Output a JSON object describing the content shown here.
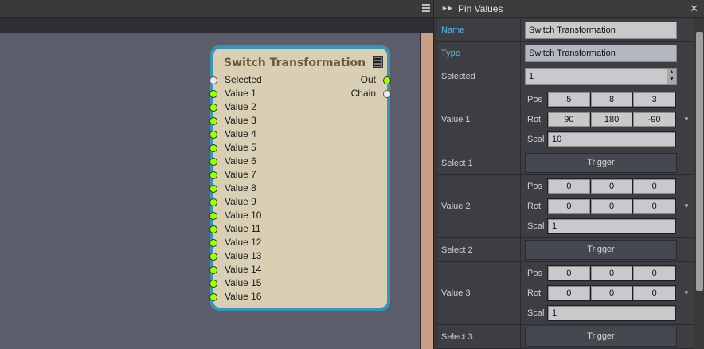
{
  "node": {
    "title": "Switch Transformation",
    "inputs": [
      {
        "label": "Selected",
        "pin": "white"
      },
      {
        "label": "Value 1",
        "pin": "green"
      },
      {
        "label": "Value 2",
        "pin": "green"
      },
      {
        "label": "Value 3",
        "pin": "green"
      },
      {
        "label": "Value 4",
        "pin": "green"
      },
      {
        "label": "Value 5",
        "pin": "green"
      },
      {
        "label": "Value 6",
        "pin": "green"
      },
      {
        "label": "Value 7",
        "pin": "green"
      },
      {
        "label": "Value 8",
        "pin": "green"
      },
      {
        "label": "Value 9",
        "pin": "green"
      },
      {
        "label": "Value 10",
        "pin": "green"
      },
      {
        "label": "Value 11",
        "pin": "green"
      },
      {
        "label": "Value 12",
        "pin": "green"
      },
      {
        "label": "Value 13",
        "pin": "green"
      },
      {
        "label": "Value 14",
        "pin": "green"
      },
      {
        "label": "Value 15",
        "pin": "green"
      },
      {
        "label": "Value 16",
        "pin": "green"
      }
    ],
    "outputs": [
      {
        "label": "Out",
        "pin": "green"
      },
      {
        "label": "Chain",
        "pin": "white"
      }
    ]
  },
  "panel": {
    "title": "Pin Values",
    "name_label": "Name",
    "name_value": "Switch Transformation",
    "type_label": "Type",
    "type_value": "Switch Transformation",
    "selected_label": "Selected",
    "selected_value": "1",
    "pos_label": "Pos",
    "rot_label": "Rot",
    "scal_label": "Scal",
    "trigger_label": "Trigger",
    "values": [
      {
        "label": "Value 1",
        "pos": [
          "5",
          "8",
          "3"
        ],
        "rot": [
          "90",
          "180",
          "-90"
        ],
        "scal": "10",
        "select_label": "Select 1"
      },
      {
        "label": "Value 2",
        "pos": [
          "0",
          "0",
          "0"
        ],
        "rot": [
          "0",
          "0",
          "0"
        ],
        "scal": "1",
        "select_label": "Select 2"
      },
      {
        "label": "Value 3",
        "pos": [
          "0",
          "0",
          "0"
        ],
        "rot": [
          "0",
          "0",
          "0"
        ],
        "scal": "1",
        "select_label": "Select 3"
      }
    ]
  },
  "colors": {
    "node_border": "#3c94b4",
    "node_body": "#d9cfb5",
    "pin_green": "#9bff1a",
    "label_blue": "#5cb6e8"
  },
  "icons": [
    "menu-icon",
    "collapse-icon",
    "panel-grip-icon",
    "close-icon",
    "spinner-icon",
    "dropdown-arrow-icon"
  ]
}
